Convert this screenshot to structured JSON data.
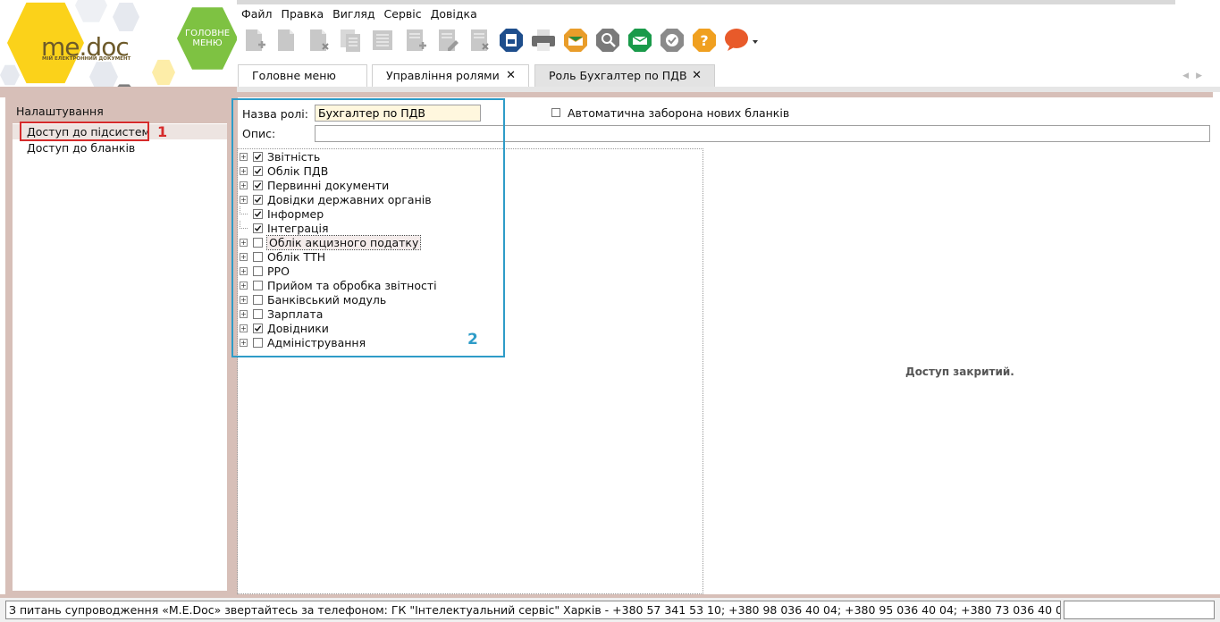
{
  "logo": {
    "brand": "me",
    "brand_suffix": "doc",
    "subtitle": "МІЙ ЕЛЕКТРОННИЙ ДОКУМЕНТ",
    "main_menu_label": "ГОЛОВНЕ МЕНЮ"
  },
  "menubar": [
    "Файл",
    "Правка",
    "Вигляд",
    "Сервіс",
    "Довідка"
  ],
  "toolbar": [
    {
      "icon": "add-document-icon",
      "color": "#c8c8c8"
    },
    {
      "icon": "open-document-icon",
      "color": "#c8c8c8"
    },
    {
      "icon": "delete-document-icon",
      "color": "#c8c8c8"
    },
    {
      "icon": "copy-document-icon",
      "color": "#c8c8c8"
    },
    {
      "icon": "document-list-icon",
      "color": "#c8c8c8"
    },
    {
      "icon": "new-document-icon",
      "color": "#c8c8c8"
    },
    {
      "icon": "edit-document-icon",
      "color": "#c8c8c8"
    },
    {
      "icon": "remove-document-icon",
      "color": "#c8c8c8"
    },
    {
      "icon": "archive-icon",
      "color": "#1e4e8c"
    },
    {
      "icon": "print-icon",
      "color": "#6d6d6d"
    },
    {
      "icon": "send-icon",
      "color": "#e99d2a"
    },
    {
      "icon": "search-icon",
      "color": "#7a7a7a"
    },
    {
      "icon": "receive-icon",
      "color": "#1a9a4a"
    },
    {
      "icon": "verify-icon",
      "color": "#8a8a8a"
    },
    {
      "icon": "help-icon",
      "color": "#f0a020"
    },
    {
      "icon": "chat-icon",
      "color": "#e85a2a"
    }
  ],
  "tabs": [
    {
      "label": "Головне меню",
      "closable": false
    },
    {
      "label": "Управління ролями",
      "closable": true
    },
    {
      "label": "Роль Бухгалтер по ПДВ",
      "closable": true
    }
  ],
  "tab_close_glyph": "✕",
  "tab_nav_glyph": "◀▶",
  "left_panel": {
    "title": "Налаштування",
    "items": [
      "Доступ до підсистем",
      "Доступ до бланків"
    ],
    "selected_index": 0
  },
  "form": {
    "role_name_label": "Назва ролі:",
    "role_name_value": "Бухгалтер по ПДВ",
    "description_label": "Опис:",
    "description_value": "",
    "auto_ban_label": "Автоматична заборона нових бланків",
    "auto_ban_checked": false
  },
  "tree": [
    {
      "label": "Звітність",
      "checked": true,
      "expandable": true
    },
    {
      "label": "Облік ПДВ",
      "checked": true,
      "expandable": true
    },
    {
      "label": "Первинні документи",
      "checked": true,
      "expandable": true
    },
    {
      "label": "Довідки державних органів",
      "checked": true,
      "expandable": true
    },
    {
      "label": "Інформер",
      "checked": true,
      "expandable": false
    },
    {
      "label": "Інтеграція",
      "checked": true,
      "expandable": false
    },
    {
      "label": "Облік акцизного податку",
      "checked": false,
      "expandable": true,
      "focused": true
    },
    {
      "label": "Облік ТТН",
      "checked": false,
      "expandable": true
    },
    {
      "label": "РРО",
      "checked": false,
      "expandable": true
    },
    {
      "label": "Прийом та обробка звітності",
      "checked": false,
      "expandable": true
    },
    {
      "label": "Банківський модуль",
      "checked": false,
      "expandable": true
    },
    {
      "label": "Зарплата",
      "checked": false,
      "expandable": true
    },
    {
      "label": "Довідники",
      "checked": true,
      "expandable": true
    },
    {
      "label": "Адміністрування",
      "checked": false,
      "expandable": true
    }
  ],
  "access_closed": "Доступ закритий.",
  "annotations": [
    "1",
    "2"
  ],
  "statusbar": {
    "text": "З питань супроводження «M.E.Doc» звертайтесь за телефоном: ГК \"Інтелектуальний сервіс\" Харків - +380 57 341 53 10; +380 98 036 40 04; +380 95 036 40 04; +380 73 036 40 04",
    "right": ""
  },
  "colors": {
    "frame": "#d7bfb8",
    "annotation_red": "#d62b2b",
    "annotation_blue": "#2e9cc8",
    "main_menu_green": "#7ec242",
    "input_highlight": "#fff7de"
  }
}
